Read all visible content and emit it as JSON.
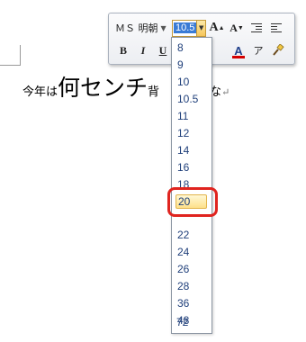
{
  "document": {
    "prefix": "今年は",
    "highlight": "何センチ",
    "hidden_char": "背",
    "suffix": "るかな",
    "para_mark": "↵"
  },
  "mini_toolbar": {
    "font_name": "ＭＳ 明朝",
    "font_size": "10.5",
    "bold_label": "B",
    "italic_label": "I",
    "underline_label": "U",
    "grow_label": "A",
    "shrink_label": "A",
    "font_color_label": "A",
    "phonetic_label": "ア",
    "accent_color": "#d40000"
  },
  "size_options": [
    "8",
    "9",
    "10",
    "10.5",
    "11",
    "12",
    "14",
    "16",
    "18",
    "20",
    "22",
    "24",
    "26",
    "28",
    "36",
    "48",
    "72"
  ],
  "selected_size": "20",
  "annotation_color": "#e0241f"
}
